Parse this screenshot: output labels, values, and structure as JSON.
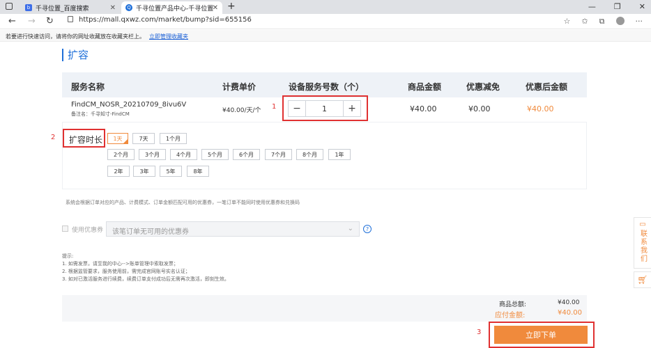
{
  "browser": {
    "tabs": [
      {
        "title": "千寻位置_百度搜索",
        "active": false
      },
      {
        "title": "千寻位置产品中心-千寻位置",
        "active": true
      }
    ],
    "new_tab": "+",
    "url": "https://mall.qxwz.com/market/bump?sid=655156",
    "favorites_hint": "若要进行快速访问，请将你的网址收藏放在收藏夹栏上。",
    "favorites_link": "立即管理收藏夹"
  },
  "page": {
    "title": "扩容",
    "table": {
      "headers": {
        "service_name": "服务名称",
        "unit_price": "计费单价",
        "quantity": "设备服务号数（个）",
        "amount": "商品金额",
        "discount": "优惠减免",
        "final": "优惠后金额"
      },
      "row": {
        "name": "FindCM_NOSR_20210709_8ivu6V",
        "remark": "备注名：千寻知寸-FindCM",
        "price": "¥40.00/天/个",
        "quantity": "1",
        "amount": "¥40.00",
        "discount": "¥0.00",
        "final": "¥40.00"
      }
    },
    "duration": {
      "label": "扩容时长",
      "rows": [
        [
          "1天",
          "7天",
          "1个月"
        ],
        [
          "2个月",
          "3个月",
          "4个月",
          "5个月",
          "6个月",
          "7个月",
          "8个月",
          "1年"
        ],
        [
          "2年",
          "3年",
          "5年",
          "8年"
        ]
      ],
      "selected": "1天"
    },
    "note": "系统会根据订单对应的产品、计费模式、订单金额匹配可用的优惠券，一笔订单不能同时使用优惠券和兑换码",
    "coupon": {
      "label": "使用优惠券",
      "placeholder": "该笔订单无可用的优惠券",
      "help": "?"
    },
    "tips": {
      "title": "提示:",
      "lines": [
        "1. 如需发票，请至我的中心-->账单管理中索取发票；",
        "2. 根据监管要求，服务使用前，需完成官网账号实名认证；",
        "3. 如对已激活服务进行续费，续费订单支付成功后无需再次激活，即刻生效。"
      ]
    },
    "summary": {
      "total_label": "商品总额:",
      "total_value": "¥40.00",
      "payable_label": "应付金额:",
      "payable_value": "¥40.00"
    },
    "order_button": "立即下单",
    "side": {
      "contact": "联系我们"
    },
    "annotations": [
      "1",
      "2",
      "3"
    ]
  },
  "colors": {
    "accent": "#1e6fd9",
    "orange": "#f08a3c",
    "annotation_red": "#e03131"
  }
}
